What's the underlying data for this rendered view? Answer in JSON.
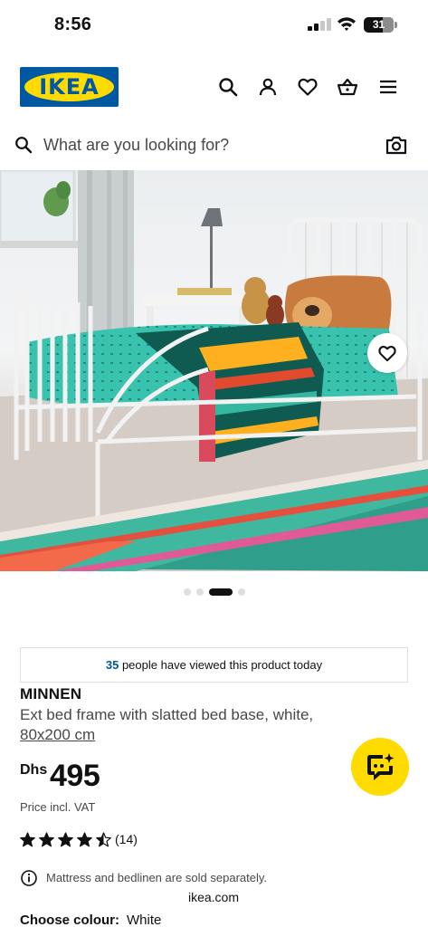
{
  "status_bar": {
    "time": "8:56",
    "battery": "31"
  },
  "header": {
    "logo_text": "IKEA"
  },
  "search": {
    "placeholder": "What are you looking for?"
  },
  "gallery": {
    "image_count": 4,
    "active_index": 2
  },
  "viewed_notice": {
    "count": "35",
    "text": " people have viewed this product today"
  },
  "product": {
    "name": "MINNEN",
    "description": "Ext bed frame with slatted bed base, white,",
    "size": "80x200 cm",
    "price_currency": "Dhs",
    "price_value": "495",
    "price_note": "Price incl. VAT",
    "rating": 4.5,
    "review_count": "(14)",
    "info_note": "Mattress and bedlinen are sold separately.",
    "colour_label": "Choose colour:",
    "colour_value": "White"
  },
  "browser": {
    "url": "ikea.com"
  },
  "colors": {
    "ikea_blue": "#0058a3",
    "ikea_yellow": "#ffdb00",
    "text": "#111111"
  },
  "icons": [
    "search-icon",
    "account-icon",
    "heart-icon",
    "basket-icon",
    "menu-icon",
    "camera-icon",
    "info-icon",
    "chat-icon"
  ]
}
